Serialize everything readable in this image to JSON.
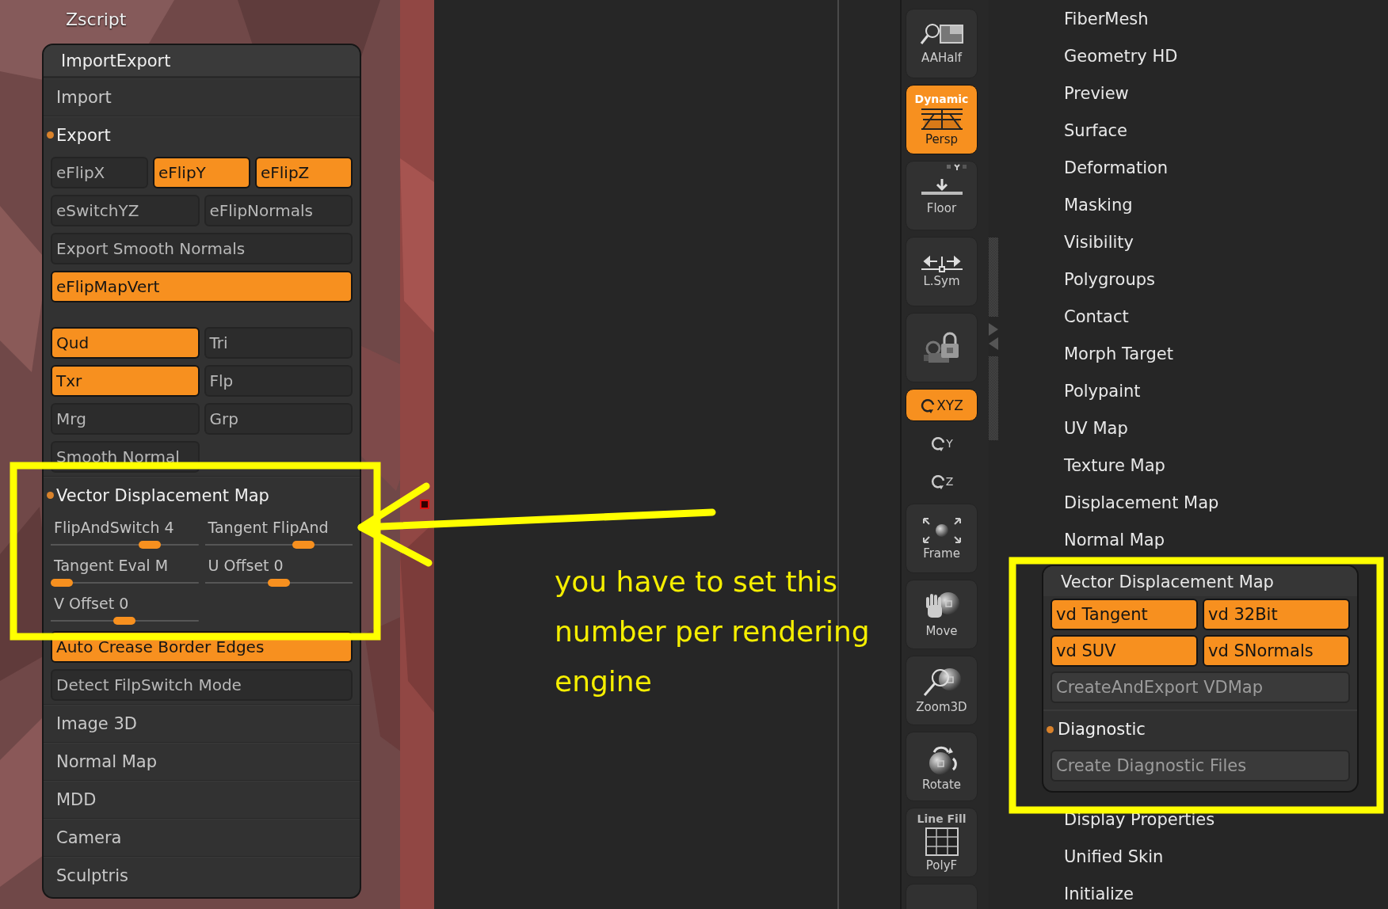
{
  "palette_title": "Zscript",
  "palette": {
    "title": "ImportExport",
    "rows": [
      {
        "kind": "header",
        "label": "Import",
        "expanded": false
      },
      {
        "kind": "header",
        "label": "Export",
        "expanded": true
      },
      {
        "kind": "buttons",
        "buttons": [
          {
            "label": "eFlipX",
            "on": false
          },
          {
            "label": "eFlipY",
            "on": true
          },
          {
            "label": "eFlipZ",
            "on": true
          }
        ]
      },
      {
        "kind": "buttons",
        "buttons": [
          {
            "label": "eSwitchYZ",
            "on": false
          },
          {
            "label": "eFlipNormals",
            "on": false
          }
        ]
      },
      {
        "kind": "buttons",
        "buttons": [
          {
            "label": "Export Smooth Normals",
            "on": false
          }
        ]
      },
      {
        "kind": "buttons",
        "buttons": [
          {
            "label": "eFlipMapVert",
            "on": true
          }
        ]
      },
      {
        "kind": "spacer"
      },
      {
        "kind": "buttons",
        "buttons": [
          {
            "label": "Qud",
            "on": true
          },
          {
            "label": "Tri",
            "on": false
          }
        ]
      },
      {
        "kind": "buttons",
        "buttons": [
          {
            "label": "Txr",
            "on": true
          },
          {
            "label": "Flp",
            "on": false
          }
        ]
      },
      {
        "kind": "buttons",
        "buttons": [
          {
            "label": "Mrg",
            "on": false
          },
          {
            "label": "Grp",
            "on": false
          }
        ]
      },
      {
        "kind": "half_button",
        "buttons": [
          {
            "label": "Smooth Normal",
            "on": false
          }
        ]
      },
      {
        "kind": "header",
        "label": "Vector Displacement Map",
        "expanded": true
      },
      {
        "kind": "sliders",
        "sliders": [
          {
            "label": "FlipAndSwitch 4",
            "level": 0.7
          },
          {
            "label": "Tangent FlipAnd",
            "level": 0.7
          }
        ]
      },
      {
        "kind": "sliders",
        "sliders": [
          {
            "label": "Tangent Eval M",
            "level": 0.0
          },
          {
            "label": "U Offset 0",
            "level": 0.5
          }
        ]
      },
      {
        "kind": "sliders",
        "sliders": [
          {
            "label": "V Offset 0",
            "level": 0.5
          }
        ]
      },
      {
        "kind": "buttons",
        "buttons": [
          {
            "label": "Auto Crease Border Edges",
            "on": true
          }
        ]
      },
      {
        "kind": "buttons",
        "buttons": [
          {
            "label": "Detect FilpSwitch Mode",
            "on": false
          }
        ]
      },
      {
        "kind": "header",
        "label": "Image 3D",
        "expanded": false
      },
      {
        "kind": "header",
        "label": "Normal Map",
        "expanded": false
      },
      {
        "kind": "header",
        "label": "MDD",
        "expanded": false
      },
      {
        "kind": "header",
        "label": "Camera",
        "expanded": false
      },
      {
        "kind": "header",
        "label": "Sculptris",
        "expanded": false
      }
    ]
  },
  "toolbar": [
    {
      "kind": "aahalf",
      "label": "AAHalf",
      "on": false
    },
    {
      "kind": "persp",
      "caption": "Dynamic",
      "label": "Persp",
      "on": true
    },
    {
      "kind": "floor",
      "label": "Floor",
      "on": false
    },
    {
      "kind": "lsym",
      "label": "L.Sym",
      "on": false
    },
    {
      "kind": "camlock",
      "on": false
    },
    {
      "kind": "xyz",
      "label": "XYZ",
      "on": true
    },
    {
      "kind": "rotaxis",
      "label": "Y"
    },
    {
      "kind": "rotaxis",
      "label": "Z"
    },
    {
      "kind": "frame",
      "label": "Frame",
      "on": false
    },
    {
      "kind": "move",
      "label": "Move",
      "on": false
    },
    {
      "kind": "zoom3d",
      "label": "Zoom3D",
      "on": false
    },
    {
      "kind": "rotate",
      "label": "Rotate",
      "on": false
    },
    {
      "kind": "polyf",
      "caption": "Line Fill",
      "label": "PolyF",
      "on": false
    },
    {
      "kind": "partial"
    }
  ],
  "tool_menu": {
    "items_before": [
      "FiberMesh",
      "Geometry HD",
      "Preview",
      "Surface",
      "Deformation",
      "Masking",
      "Visibility",
      "Polygroups",
      "Contact",
      "Morph Target",
      "Polypaint",
      "UV Map",
      "Texture Map",
      "Displacement Map",
      "Normal Map"
    ],
    "panel": {
      "title": "Vector Displacement Map",
      "toggles": [
        {
          "label": "vd Tangent",
          "on": true
        },
        {
          "label": "vd 32Bit",
          "on": true
        },
        {
          "label": "vd SUV",
          "on": true
        },
        {
          "label": "vd SNormals",
          "on": true
        }
      ],
      "action": "CreateAndExport VDMap",
      "section": {
        "label": "Diagnostic",
        "expanded": true
      },
      "section_action": "Create Diagnostic Files"
    },
    "items_after": [
      "Display Properties",
      "Unified Skin",
      "Initialize"
    ]
  },
  "annotation": {
    "note": "you have to set this\nnumber per rendering\nengine"
  }
}
